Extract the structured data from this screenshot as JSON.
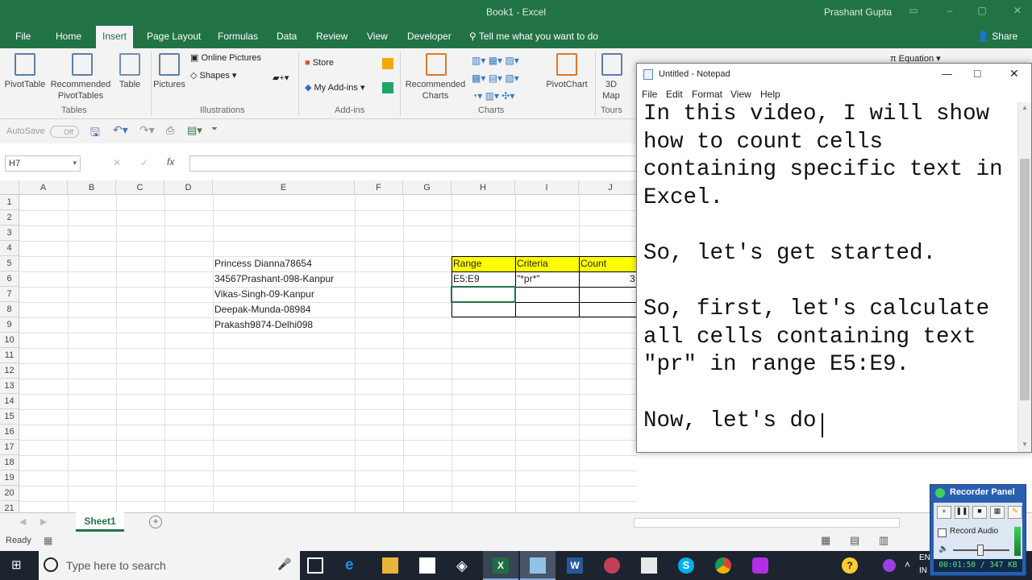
{
  "excel": {
    "window_title": "Book1 - Excel",
    "user_name": "Prashant Gupta",
    "tabs": [
      "File",
      "Home",
      "Insert",
      "Page Layout",
      "Formulas",
      "Data",
      "Review",
      "View",
      "Developer"
    ],
    "active_tab": "Insert",
    "tell_me": "Tell me what you want to do",
    "share": "Share",
    "ribbon": {
      "pivottable": "PivotTable",
      "recommended_pivottables": "Recommended PivotTables",
      "table": "Table",
      "pictures": "Pictures",
      "online_pictures": "Online Pictures",
      "shapes": "Shapes",
      "store": "Store",
      "my_addins": "My Add-ins",
      "recommended_charts": "Recommended Charts",
      "pivotchart": "PivotChart",
      "map_3d": "3D Map",
      "equation": "Equation",
      "groups": {
        "tables": "Tables",
        "illustrations": "Illustrations",
        "addins": "Add-ins",
        "charts": "Charts",
        "tours": "Tours"
      }
    },
    "autosave": "AutoSave",
    "autosave_state": "Off",
    "name_box": "H7",
    "formula": "",
    "columns": [
      "A",
      "B",
      "C",
      "D",
      "E",
      "F",
      "G",
      "H",
      "I",
      "J"
    ],
    "rows": [
      "1",
      "2",
      "3",
      "4",
      "5",
      "6",
      "7",
      "8",
      "9",
      "10",
      "11",
      "12",
      "13",
      "14",
      "15",
      "16",
      "17",
      "18",
      "19",
      "20",
      "21"
    ],
    "cells": {
      "E5": "Princess Dianna78654",
      "E6": "34567Prashant-098-Kanpur",
      "E7": "Vikas-Singh-09-Kanpur",
      "E8": "Deepak-Munda-08984",
      "E9": "Prakash9874-Delhi098",
      "H5": "Range",
      "I5": "Criteria",
      "J5": "Count",
      "H6": "E5:E9",
      "I6": "\"*pr*\"",
      "J6": "3"
    },
    "header_fill": "#ffff00",
    "sheet_tab": "Sheet1",
    "status": "Ready"
  },
  "notepad": {
    "title": "Untitled - Notepad",
    "menu": [
      "File",
      "Edit",
      "Format",
      "View",
      "Help"
    ],
    "text": "In this video, I will show\nhow to count cells\ncontaining specific text in\nExcel.\n\nSo, let's get started.\n\nSo, first, let's calculate\nall cells containing text\n\"pr\" in range E5:E9.\n\nNow, let's do"
  },
  "taskbar": {
    "search_placeholder": "Type here to search",
    "lang_top": "EN",
    "lang_bottom": "IN"
  },
  "recorder": {
    "title": "Recorder Panel",
    "record_audio": "Record Audio",
    "stats": "00:01:50 / 347 KB"
  },
  "colors": {
    "excel_green": "#217346",
    "taskbar": "#1c2430",
    "recorder_blue": "#2a5fb0"
  }
}
